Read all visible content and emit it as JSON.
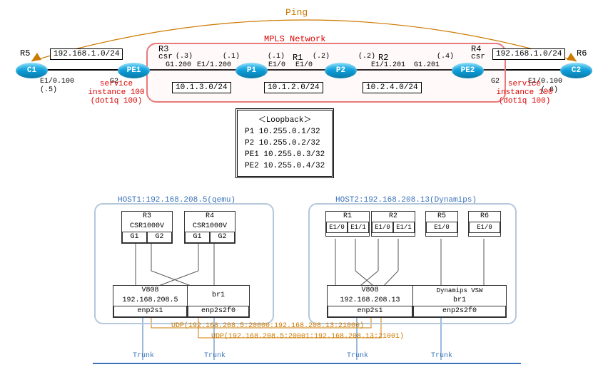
{
  "top": {
    "ping": "Ping",
    "mpls": "MPLS Network",
    "r5": "R5",
    "r6": "R6",
    "r3": "R3",
    "r4": "R4",
    "r1": "R1",
    "r2": "R2",
    "csr_left": "csr",
    "csr_right": "csr",
    "c1": "C1",
    "c2": "C2",
    "pe1": "PE1",
    "pe2": "PE2",
    "p1": "P1",
    "p2": "P2",
    "net_left": "192.168.1.0/24",
    "net_right": "192.168.1.0/24",
    "svc_left_l1": "service",
    "svc_left_l2": "instance 100",
    "svc_left_l3": "(dot1q 100)",
    "svc_right_l1": "service",
    "svc_right_l2": "instance 100",
    "svc_right_l3": "(dot1q 100)",
    "e10_100_l": "E1/0.100",
    "e10_100_r": "E1/0.100",
    "dot5": "(.5)",
    "dot6": "(.6)",
    "dot3": "(.3)",
    "dot1a": "(.1)",
    "dot1b": "(.1)",
    "dot2a": "(.2)",
    "dot2b": "(.2)",
    "dot4": "(.4)",
    "g1_200": "G1.200",
    "g1_201": "G1.201",
    "e11_200": "E1/1.200",
    "e11_201": "E1/1.201",
    "e10_a": "E1/0",
    "e10_b": "E1/0",
    "g2_l": "G2",
    "g2_r": "G2",
    "subnet_13": "10.1.3.0/24",
    "subnet_12": "10.1.2.0/24",
    "subnet_24": "10.2.4.0/24"
  },
  "loopback": {
    "title": "＜Loopback＞",
    "l1": "P1 10.255.0.1/32",
    "l2": "P2 10.255.0.2/32",
    "l3": "PE1 10.255.0.3/32",
    "l4": "PE2 10.255.0.4/32"
  },
  "host1": {
    "title": "HOST1:192.168.208.5(qemu)",
    "r3": "R3",
    "r3_sub": "CSR1000V",
    "r4": "R4",
    "r4_sub": "CSR1000V",
    "g1_a": "G1",
    "g2_a": "G2",
    "g1_b": "G1",
    "g2_b": "G2",
    "v808": "V808",
    "ip": "192.168.208.5",
    "br1": "br1",
    "enp1": "enp2s1",
    "enp2": "enp2s2f0"
  },
  "host2": {
    "title": "HOST2:192.168.208.13(Dynamips)",
    "r1": "R1",
    "r2": "R2",
    "r5": "R5",
    "r6": "R6",
    "e10_a": "E1/0",
    "e11_a": "E1/1",
    "e10_b": "E1/0",
    "e11_b": "E1/1",
    "e10_c": "E1/0",
    "e10_d": "E1/0",
    "v808": "V808",
    "ip": "192.168.208.13",
    "dvsw": "Dynamips VSW",
    "br1": "br1",
    "enp1": "enp2s1",
    "enp2": "enp2s2f0"
  },
  "udp1": "UDP(192.168.208.5:20000:192.168.208.13:21000)",
  "udp2": "UDP(192.168.208.5:20001:192.168.208.13:21001)",
  "trunk": "Trunk"
}
